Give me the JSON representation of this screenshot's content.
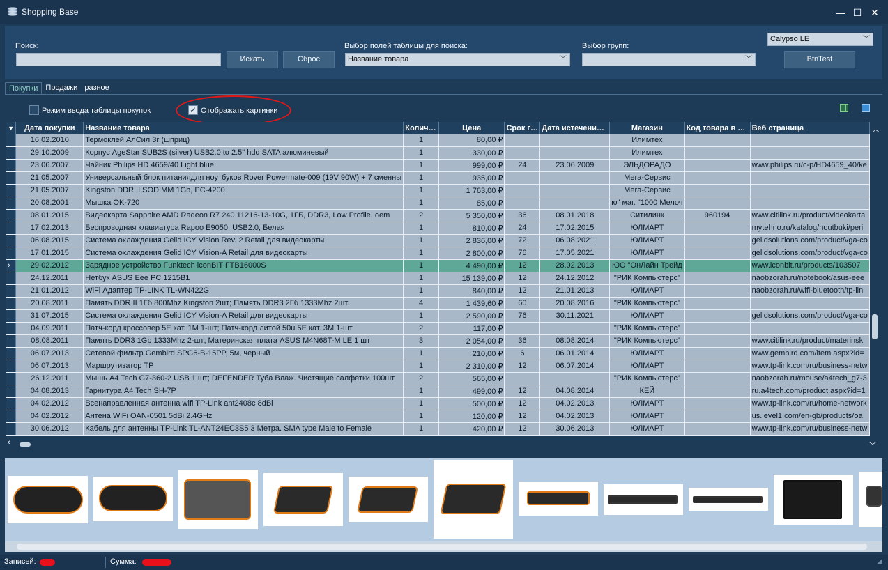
{
  "window": {
    "title": "Shopping Base",
    "min": "—",
    "max": "☐",
    "close": "✕"
  },
  "search": {
    "search_label": "Поиск:",
    "search_value": "",
    "find_button": "Искать",
    "reset_button": "Сброс",
    "fields_label": "Выбор полей таблицы для поиска:",
    "fields_value": "Название товара",
    "groups_label": "Выбор групп:",
    "groups_value": "",
    "theme_value": "Calypso LE",
    "test_button": "BtnTest"
  },
  "tabs": [
    "Покупки",
    "Продажи",
    "разное"
  ],
  "options": {
    "input_mode": "Режим ввода таблицы покупок",
    "show_images": "Отображать картинки"
  },
  "columns": [
    "Дата покупки",
    "Название товара",
    "Количество",
    "Цена",
    "Срок гарантии",
    "Дата истечения гарантии",
    "Магазин",
    "Код товара в магазине",
    "Веб страница"
  ],
  "columns_display": [
    "Дата покупки",
    "Название товара",
    "Колич…",
    "Цена",
    "Срок г…",
    "Дата истечени…",
    "Магазин",
    "Код товара в …",
    "Веб страница"
  ],
  "rows": [
    [
      "16.02.2010",
      "Термоклей АлСил 3г (шприц)",
      "1",
      "80,00 ₽",
      "",
      "",
      "Илимтех",
      "",
      ""
    ],
    [
      "29.10.2009",
      "Корпус AgeStar SUB2S (silver) USB2.0 to 2.5\" hdd SATA алюминевый",
      "1",
      "330,00 ₽",
      "",
      "",
      "Илимтех",
      "",
      ""
    ],
    [
      "23.06.2007",
      "Чайник Philips HD 4659/40 Light blue",
      "1",
      "999,00 ₽",
      "24",
      "23.06.2009",
      "ЭЛЬДОРАДО",
      "",
      "www.philips.ru/c-p/HD4659_40/ke"
    ],
    [
      "21.05.2007",
      "Универсальный блок питаниядля ноутбуков Rover Powermate-009 (19V 90W) + 7 сменны",
      "1",
      "935,00 ₽",
      "",
      "",
      "Мега-Сервис",
      "",
      ""
    ],
    [
      "21.05.2007",
      "Kingston DDR II SODIMM 1Gb, PC-4200",
      "1",
      "1 763,00 ₽",
      "",
      "",
      "Мега-Сервис",
      "",
      ""
    ],
    [
      "20.08.2001",
      "Мышка OK-720",
      "1",
      "85,00 ₽",
      "",
      "",
      "ю\" маг. \"1000 Мелоч",
      "",
      ""
    ],
    [
      "08.01.2015",
      "Видеокарта Sapphire AMD Radeon R7 240 11216-13-10G, 1ГБ, DDR3, Low Profile, oem",
      "2",
      "5 350,00 ₽",
      "36",
      "08.01.2018",
      "Ситилинк",
      "960194",
      "www.citilink.ru/product/videokarta"
    ],
    [
      "17.02.2013",
      "Беспроводная клавиатура Rapoo E9050, USB2.0, Белая",
      "1",
      "810,00 ₽",
      "24",
      "17.02.2015",
      "ЮЛМАРТ",
      "",
      "mytehno.ru/katalog/noutbuki/peri"
    ],
    [
      "06.08.2015",
      "Система охлаждения Gelid ICY Vision Rev. 2 Retail для видеокарты",
      "1",
      "2 836,00 ₽",
      "72",
      "06.08.2021",
      "ЮЛМАРТ",
      "",
      "gelidsolutions.com/product/vga-co"
    ],
    [
      "17.01.2015",
      "Система охлаждения Gelid ICY Vision-A  Retail для видеокарты",
      "1",
      "2 800,00 ₽",
      "76",
      "17.05.2021",
      "ЮЛМАРТ",
      "",
      "gelidsolutions.com/product/vga-co"
    ],
    [
      "29.02.2012",
      "Зарядное устройство Funktech iconBIT FTB16000S",
      "1",
      "4 490,00 ₽",
      "12",
      "28.02.2013",
      "ЮО \"ОнЛайн Трейд",
      "",
      "www.iconbit.ru/products/103507"
    ],
    [
      "24.12.2011",
      "Нетбук ASUS Eee PC 1215B1",
      "1",
      "15 139,00 ₽",
      "12",
      "24.12.2012",
      "\"РИК Компьютерс\"",
      "",
      "naobzorah.ru/notebook/asus-eee"
    ],
    [
      "21.01.2012",
      "WiFi Адаптер TP-LINK TL-WN422G",
      "1",
      "840,00 ₽",
      "12",
      "21.01.2013",
      "ЮЛМАРТ",
      "",
      "naobzorah.ru/wifi-bluetooth/tp-lin"
    ],
    [
      "20.08.2011",
      "Память DDR II 1Гб  800Mhz Kingston 2шт; Память DDR3 2Гб 1333Mhz 2шт.",
      "4",
      "1 439,60 ₽",
      "60",
      "20.08.2016",
      "\"РИК Компьютерс\"",
      "",
      ""
    ],
    [
      "31.07.2015",
      "Система охлаждения Gelid ICY Vision-A  Retail для видеокарты",
      "1",
      "2 590,00 ₽",
      "76",
      "30.11.2021",
      "ЮЛМАРТ",
      "",
      "gelidsolutions.com/product/vga-co"
    ],
    [
      "04.09.2011",
      "Патч-корд кроссовер 5Е кат. 1М 1-шт; Патч-корд литой 50u 5Е кат. 3М 1-шт",
      "2",
      "117,00 ₽",
      "",
      "",
      "\"РИК Компьютерс\"",
      "",
      ""
    ],
    [
      "08.08.2011",
      "Память DDR3 1Gb 1333Mhz 2-шт; Материнская плата ASUS M4N68T-M LE 1 шт",
      "3",
      "2 054,00 ₽",
      "36",
      "08.08.2014",
      "\"РИК Компьютерс\"",
      "",
      "www.citilink.ru/product/materinsk"
    ],
    [
      "06.07.2013",
      "Сетевой фильтр Gembird SPG6-B-15PP, 5м, черный",
      "1",
      "210,00 ₽",
      "6",
      "06.01.2014",
      "ЮЛМАРТ",
      "",
      "www.gembird.com/item.aspx?id="
    ],
    [
      "06.07.2013",
      "Маршрутизатор TP",
      "1",
      "2 310,00 ₽",
      "12",
      "06.07.2014",
      "ЮЛМАРТ",
      "",
      "www.tp-link.com/ru/business-netw"
    ],
    [
      "26.12.2011",
      "Мышь A4 Tech G7-360-2 USB 1 шт; DEFENDER Туба Влаж. Чистящие салфетки 100шт",
      "2",
      "565,00 ₽",
      "",
      "",
      "\"РИК Компьютерс\"",
      "",
      "naobzorah.ru/mouse/a4tech_g7-3"
    ],
    [
      "04.08.2013",
      "Гарнитура A4 Tech SH-7P",
      "1",
      "499,00 ₽",
      "12",
      "04.08.2014",
      "КЕЙ",
      "",
      "ru.a4tech.com/product.aspx?id=1"
    ],
    [
      "04.02.2012",
      "Всенаправленная антенна wifi TP-Link ant2408c 8dBi",
      "1",
      "500,00 ₽",
      "12",
      "04.02.2013",
      "ЮЛМАРТ",
      "",
      "www.tp-link.com/ru/home-network"
    ],
    [
      "04.02.2012",
      "Антена WiFi OAN-0501 5dBi 2.4GHz",
      "1",
      "120,00 ₽",
      "12",
      "04.02.2013",
      "ЮЛМАРТ",
      "",
      "us.level1.com/en-gb/products/oa"
    ],
    [
      "30.06.2012",
      "Кабель для антенны TP-Link TL-ANT24EC3S5 3 Метра. SMA type Male to Female",
      "1",
      "420,00 ₽",
      "12",
      "30.06.2013",
      "ЮЛМАРТ",
      "",
      "www.tp-link.com/ru/business-netw"
    ]
  ],
  "status": {
    "records_label": "Записей:",
    "sum_label": "Сумма:"
  },
  "colors": {
    "accent": "#5fa796",
    "window": "#1d3a57",
    "panel": "#24486b",
    "grid": "#a8b8c8",
    "annotation": "#e01818"
  }
}
